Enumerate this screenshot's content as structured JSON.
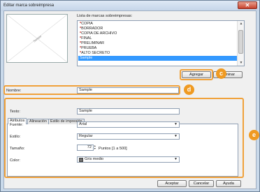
{
  "window": {
    "title": "Editar marca sobreimpresa",
    "close_glyph": "✕"
  },
  "preview": {
    "watermark_text": "Sample"
  },
  "watermark_list": {
    "label": "Lista de marcas sobreimpresas:",
    "items": [
      {
        "label": "COPIA",
        "star": "*"
      },
      {
        "label": "BORRADOR",
        "star": "*"
      },
      {
        "label": "COPIA DE ARCHIVO",
        "star": "*"
      },
      {
        "label": "FINAL",
        "star": "*"
      },
      {
        "label": "PRELIMINAR",
        "star": "*"
      },
      {
        "label": "PRUEBA",
        "star": "*"
      },
      {
        "label": "ALTO SECRETO",
        "star": "*"
      },
      {
        "label": "Sample",
        "star": ""
      }
    ],
    "selected": "Sample"
  },
  "buttons": {
    "add": "Agregar",
    "delete": "Eliminar",
    "ok": "Aceptar",
    "cancel": "Cancelar",
    "help": "Ayuda"
  },
  "name_field": {
    "label": "Nombre:",
    "value": "Sample"
  },
  "tabs": [
    "Atributos",
    "Alineación",
    "Estilo de impresión"
  ],
  "attributes": {
    "text_label": "Texto:",
    "text_value": "Sample",
    "font_label": "Fuente:",
    "font_value": "Arial",
    "style_label": "Estilo:",
    "style_value": "Regular",
    "size_label": "Tamaño:",
    "size_value": "72",
    "size_hint": "Puntos [1 a 500]",
    "color_label": "Color:",
    "color_value": "Gris medio"
  },
  "callouts": {
    "c": "c",
    "d": "d",
    "e": "e"
  },
  "colors": {
    "accent_orange": "#ef9a22",
    "selection_blue": "#3399ff",
    "star_red": "#d0241c",
    "swatch_gray": "#707070"
  }
}
